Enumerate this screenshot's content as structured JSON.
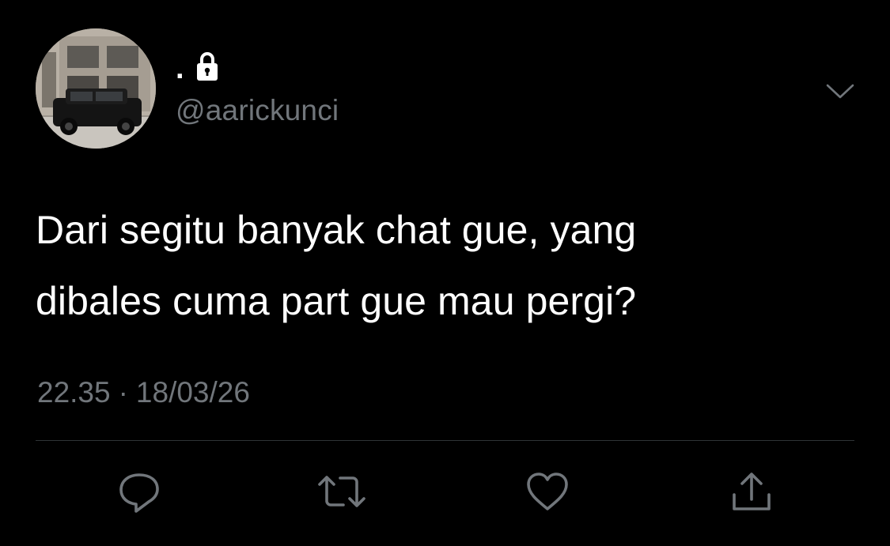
{
  "tweet": {
    "display_name": ".",
    "protected": true,
    "handle": "@aarickunci",
    "text": "Dari segitu banyak chat gue, yang\ndibales cuma part gue mau pergi?",
    "time": "22.35",
    "separator": "·",
    "date": "18/03/26"
  },
  "icons": {
    "lock": "lock-icon",
    "more": "chevron-down-icon",
    "reply": "reply-icon",
    "retweet": "retweet-icon",
    "like": "heart-icon",
    "share": "share-icon"
  },
  "colors": {
    "background": "#000000",
    "text": "#ffffff",
    "secondary": "#71767b",
    "divider": "#2f3336",
    "icon": "#71767b"
  }
}
